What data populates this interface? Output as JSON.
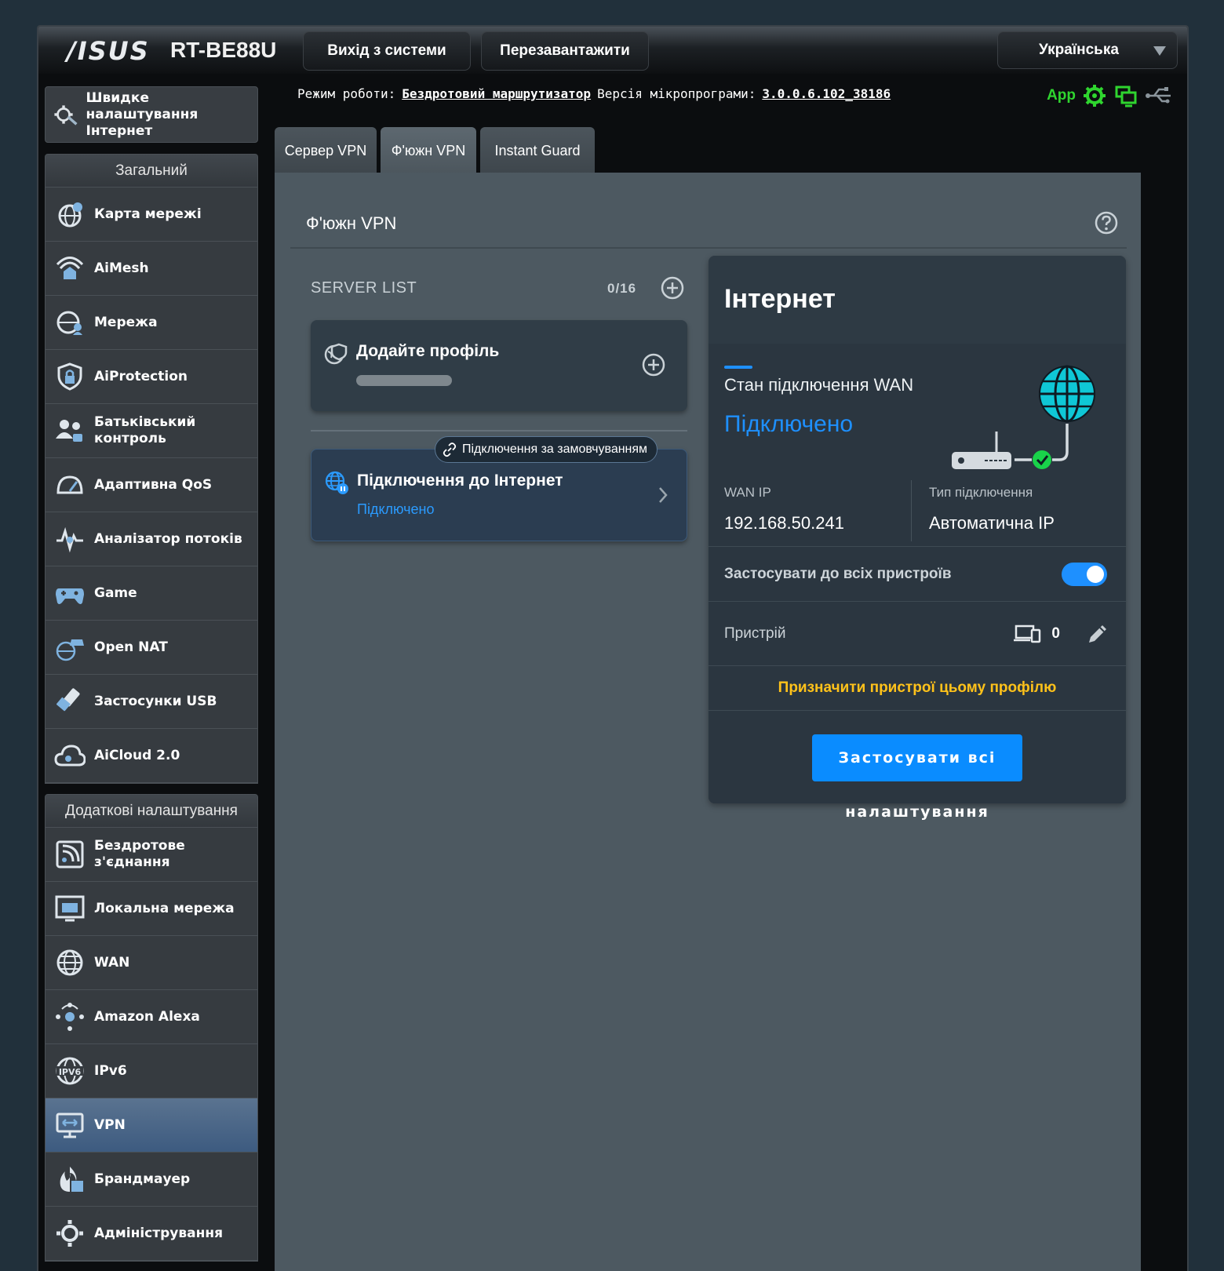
{
  "header": {
    "brand": "/ISUS",
    "model": "RT-BE88U",
    "logout_label": "Вихід з системи",
    "reboot_label": "Перезавантажити",
    "language": "Українська"
  },
  "status": {
    "mode_label": "Режим роботи:",
    "mode_value": "Бездротовий маршрутизатор",
    "firmware_label": "Версія мікропрограми:",
    "firmware_value": "3.0.0.6.102_38186",
    "app_label": "App"
  },
  "sidebar": {
    "quick_setup": "Швидке налаштування Інтернет",
    "general_title": "Загальний",
    "general_items": [
      {
        "label": "Карта мережі",
        "icon": "network-map-icon"
      },
      {
        "label": "AiMesh",
        "icon": "aimesh-icon"
      },
      {
        "label": "Мережа",
        "icon": "guest-network-icon"
      },
      {
        "label": "AiProtection",
        "icon": "aiprotection-icon"
      },
      {
        "label": "Батьківський контроль",
        "icon": "parental-control-icon"
      },
      {
        "label": "Адаптивна QoS",
        "icon": "qos-icon"
      },
      {
        "label": "Аналізатор потоків",
        "icon": "traffic-analyzer-icon"
      },
      {
        "label": "Game",
        "icon": "game-icon"
      },
      {
        "label": "Open NAT",
        "icon": "open-nat-icon"
      },
      {
        "label": "Застосунки USB",
        "icon": "usb-icon"
      },
      {
        "label": "AiCloud 2.0",
        "icon": "aicloud-icon"
      }
    ],
    "advanced_title": "Додаткові налаштування",
    "advanced_items": [
      {
        "label": "Бездротове з'єднання",
        "icon": "wireless-icon"
      },
      {
        "label": "Локальна мережа",
        "icon": "lan-icon"
      },
      {
        "label": "WAN",
        "icon": "wan-icon"
      },
      {
        "label": "Amazon Alexa",
        "icon": "alexa-icon"
      },
      {
        "label": "IPv6",
        "icon": "ipv6-icon"
      },
      {
        "label": "VPN",
        "icon": "vpn-icon",
        "active": true
      },
      {
        "label": "Брандмауер",
        "icon": "firewall-icon"
      },
      {
        "label": "Адміністрування",
        "icon": "admin-icon"
      }
    ]
  },
  "tabs": [
    {
      "label": "Сервер VPN"
    },
    {
      "label": "Ф'южн VPN",
      "active": true
    },
    {
      "label": "Instant Guard"
    }
  ],
  "main": {
    "title": "Ф'южн VPN",
    "server_list_label": "SERVER LIST",
    "server_count": "0/16",
    "add_profile": "Додайте профіль",
    "default_pill": "Підключення за замовчуванням",
    "internet_conn_title": "Підключення до Інтернет",
    "internet_conn_status": "Підключено"
  },
  "panel": {
    "title": "Інтернет",
    "wan_state_label": "Стан підключення WAN",
    "wan_state_value": "Підключено",
    "wan_ip_label": "WAN IP",
    "wan_ip_value": "192.168.50.241",
    "conn_type_label": "Тип підключення",
    "conn_type_value": "Автоматична IP",
    "apply_all_devices_label": "Застосувати до всіх пристроїв",
    "apply_all_devices_on": true,
    "device_label": "Пристрій",
    "device_count": "0",
    "assign_label": "Призначити пристрої цьому профілю",
    "apply_btn_line1": "Застосувати всі",
    "apply_btn_line2": "налаштування"
  },
  "colors": {
    "accent": "#1e90ff",
    "assign": "#ffc21a",
    "app_green": "#2fd52f"
  }
}
